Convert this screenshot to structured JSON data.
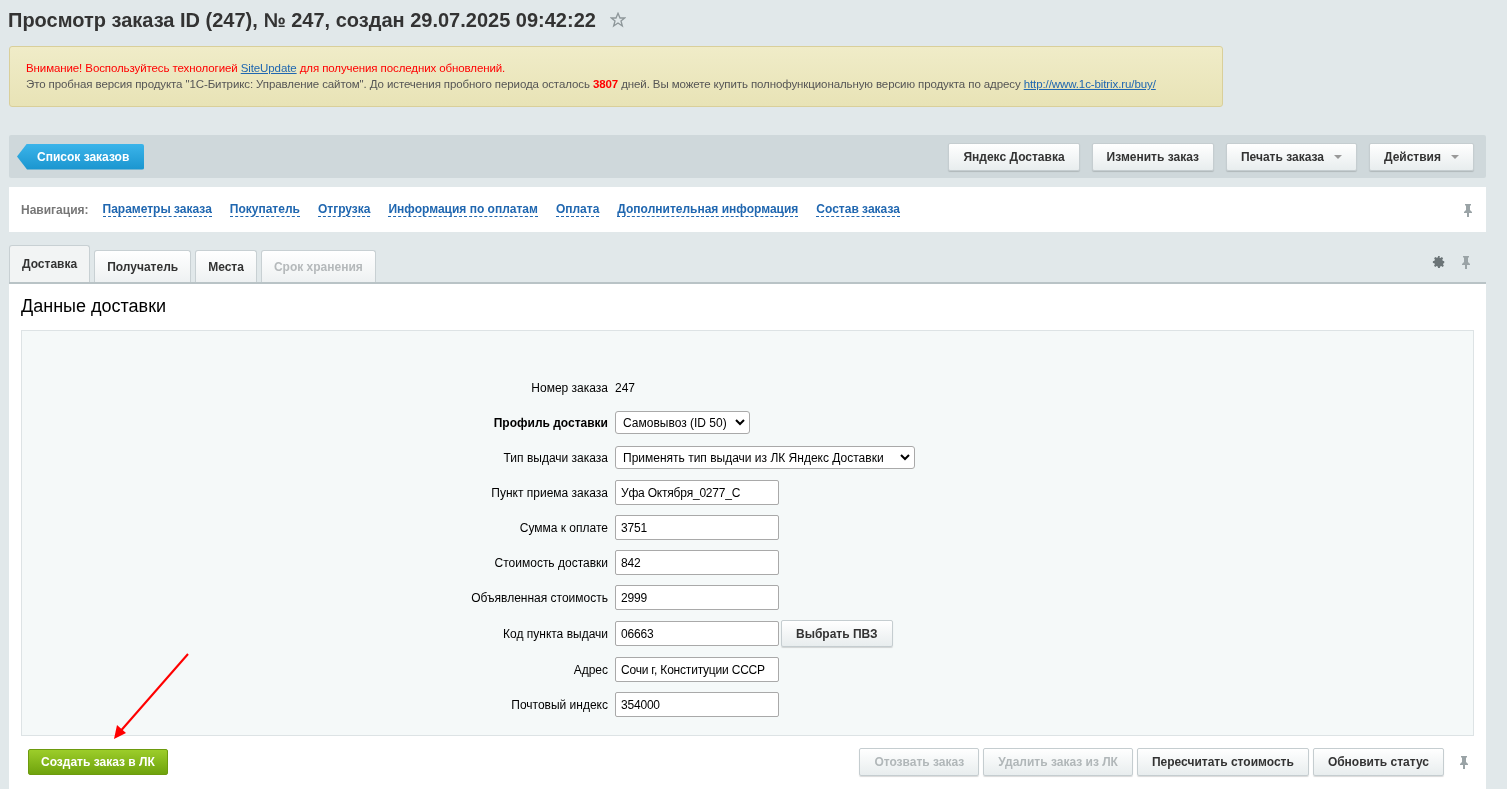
{
  "page_title": "Просмотр заказа ID (247), № 247, создан 29.07.2025 09:42:22",
  "favorite": false,
  "notice": {
    "warning": "Внимание! Воспользуйтесь технологией",
    "warning_link": "SiteUpdate",
    "warning_tail": "для получения последних обновлений.",
    "trial": "Это пробная версия продукта \"1С-Битрикс: Управление сайтом\". До истечения пробного периода осталось",
    "days": "3807",
    "trial_tail": "дней. Вы можете купить полнофункциональную версию продукта по адресу",
    "buy_link": "http://www.1c-bitrix.ru/buy/"
  },
  "toolbar": {
    "back": "Список заказов",
    "buttons": [
      {
        "label": "Яндекс Доставка",
        "dropdown": false
      },
      {
        "label": "Изменить заказ",
        "dropdown": false
      },
      {
        "label": "Печать заказа",
        "dropdown": true
      },
      {
        "label": "Действия",
        "dropdown": true
      }
    ]
  },
  "navigation": {
    "label": "Навигация:",
    "links": [
      "Параметры заказа",
      "Покупатель",
      "Отгрузка",
      "Информация по оплатам",
      "Оплата",
      "Дополнительная информация",
      "Состав заказа"
    ]
  },
  "tabs": [
    {
      "label": "Доставка",
      "selected": true,
      "disabled": false
    },
    {
      "label": "Получатель",
      "selected": false,
      "disabled": false
    },
    {
      "label": "Места",
      "selected": false,
      "disabled": false
    },
    {
      "label": "Срок хранения",
      "selected": false,
      "disabled": true
    }
  ],
  "section_title": "Данные доставки",
  "fields": [
    {
      "kind": "static",
      "label": "Номер заказа",
      "emphasized": false,
      "value": "247"
    },
    {
      "kind": "select",
      "label": "Профиль доставки",
      "emphasized": true,
      "value": "Самовывоз (ID 50)"
    },
    {
      "kind": "select",
      "label": "Тип выдачи заказа",
      "emphasized": false,
      "value": "Применять тип выдачи из ЛК Яндекс Доставки"
    },
    {
      "kind": "input",
      "label": "Пункт приема заказа",
      "emphasized": false,
      "value": "Уфа Октября_0277_С"
    },
    {
      "kind": "input",
      "label": "Сумма к оплате",
      "emphasized": false,
      "value": "3751"
    },
    {
      "kind": "input",
      "label": "Стоимость доставки",
      "emphasized": false,
      "value": "842"
    },
    {
      "kind": "input",
      "label": "Объявленная стоимость",
      "emphasized": false,
      "value": "2999"
    },
    {
      "kind": "input",
      "label": "Код пункта выдачи",
      "emphasized": false,
      "value": "06663",
      "button": "Выбрать ПВЗ"
    },
    {
      "kind": "input",
      "label": "Адрес",
      "emphasized": false,
      "value": "Сочи г, Конституции СССР"
    },
    {
      "kind": "input",
      "label": "Почтовый индекс",
      "emphasized": false,
      "value": "354000"
    }
  ],
  "primary_button": "Создать заказ в ЛК",
  "actions": [
    {
      "label": "Отозвать заказ",
      "disabled": true
    },
    {
      "label": "Удалить заказ из ЛК",
      "disabled": true
    },
    {
      "label": "Пересчитать стоимость",
      "disabled": false
    },
    {
      "label": "Обновить статус",
      "disabled": false
    }
  ]
}
